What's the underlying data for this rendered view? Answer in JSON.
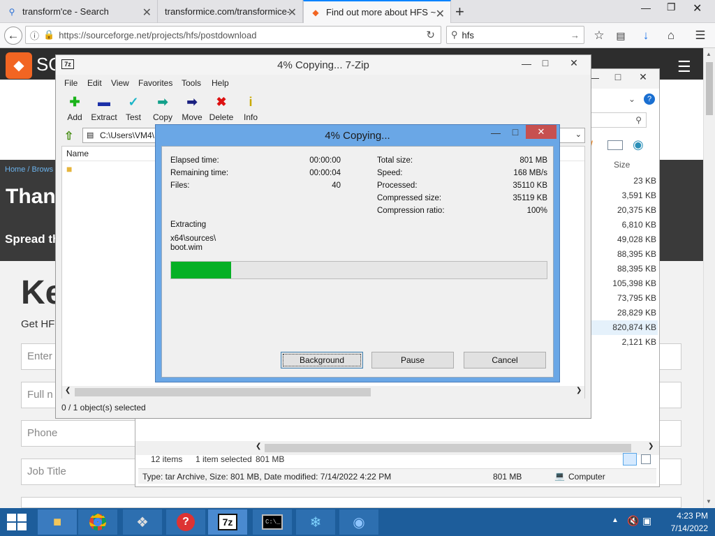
{
  "browser": {
    "tabs": [
      {
        "title": "transform'ce - Search",
        "icon": "search-icon"
      },
      {
        "title": "transformice.com/transformice-",
        "icon": "page-icon"
      },
      {
        "title": "Find out more about HFS ~",
        "icon": "sourceforge-icon"
      }
    ],
    "url": "https://sourceforge.net/projects/hfs/postdownload",
    "search_value": "hfs"
  },
  "page": {
    "logo_text": "SO",
    "breadcrumb": "Home / Brows",
    "heading": "Thank",
    "spread": "Spread th",
    "ke_heading": "Ke",
    "get_hf": "Get HF",
    "inputs": [
      "Enter",
      "Full n",
      "Phone",
      "Job Title"
    ]
  },
  "explorer": {
    "size_header": "Size",
    "sizes": [
      "23 KB",
      "3,591 KB",
      "20,375 KB",
      "6,810 KB",
      "49,028 KB",
      "88,395 KB",
      "88,395 KB",
      "105,398 KB",
      "73,795 KB",
      "28,829 KB",
      "820,874 KB",
      "2,121 KB"
    ],
    "status_items": "12 items",
    "status_selected": "1 item selected",
    "status_size": "801 MB",
    "info_text": "Type: tar Archive, Size: 801 MB, Date modified: 7/14/2022 4:22 PM",
    "info_size": "801 MB",
    "info_location": "Computer"
  },
  "sevenzip": {
    "title": "4% Copying... 7-Zip",
    "menu": [
      "File",
      "Edit",
      "View",
      "Favorites",
      "Tools",
      "Help"
    ],
    "toolbar": [
      {
        "label": "Add",
        "icon": "add-icon",
        "color": "#19b319"
      },
      {
        "label": "Extract",
        "icon": "extract-icon",
        "color": "#1a2fa8"
      },
      {
        "label": "Test",
        "icon": "test-icon",
        "color": "#1bb5c8"
      },
      {
        "label": "Copy",
        "icon": "copy-icon",
        "color": "#12a08a"
      },
      {
        "label": "Move",
        "icon": "move-icon",
        "color": "#1a2080"
      },
      {
        "label": "Delete",
        "icon": "delete-icon",
        "color": "#d11"
      },
      {
        "label": "Info",
        "icon": "info-icon",
        "color": "#c9a900"
      }
    ],
    "path": "C:\\Users\\VM4\\",
    "name_header": "Name",
    "status": "0 / 1 object(s) selected"
  },
  "progress": {
    "title": "4% Copying...",
    "left_labels": [
      "Elapsed time:",
      "Remaining time:",
      "Files:"
    ],
    "left_values": [
      "00:00:00",
      "00:00:04",
      "40"
    ],
    "right_labels": [
      "Total size:",
      "Speed:",
      "Processed:",
      "Compressed size:",
      "Compression ratio:"
    ],
    "right_values": [
      "801 MB",
      "168 MB/s",
      "35110 KB",
      "35119 KB",
      "100%"
    ],
    "action": "Extracting",
    "file_line1": "x64\\sources\\",
    "file_line2": "boot.wim",
    "progress_fraction": 0.16,
    "progress_color": "#06b025",
    "buttons": [
      "Background",
      "Pause",
      "Cancel"
    ]
  },
  "taskbar": {
    "time": "4:23 PM",
    "date": "7/14/2022",
    "apps": [
      "file-explorer-icon",
      "chrome-icon",
      "unity-icon",
      "help-icon",
      "7zip-icon",
      "terminal-icon",
      "app-icon",
      "network-icon"
    ]
  }
}
